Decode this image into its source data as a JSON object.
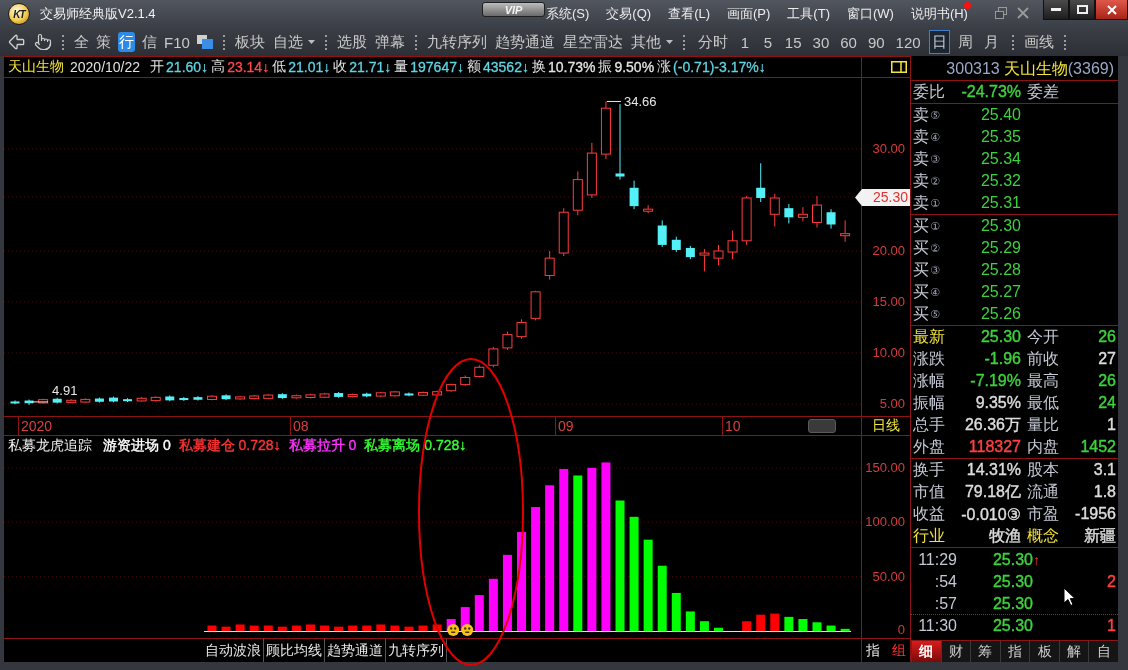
{
  "window": {
    "logo": "KT",
    "title": "交易师经典版V2.1.4",
    "vip": "VIP"
  },
  "menu": [
    {
      "label": "系统(S)",
      "badge": false
    },
    {
      "label": "交易(Q)",
      "badge": false
    },
    {
      "label": "查看(L)",
      "badge": false
    },
    {
      "label": "画面(P)",
      "badge": false
    },
    {
      "label": "工具(T)",
      "badge": false
    },
    {
      "label": "窗口(W)",
      "badge": false
    },
    {
      "label": "说明书(H)",
      "badge": true
    }
  ],
  "toolbar": {
    "views": [
      {
        "label": "全",
        "selected": false
      },
      {
        "label": "策",
        "selected": false
      },
      {
        "label": "行",
        "selected": true
      },
      {
        "label": "信",
        "selected": false
      },
      {
        "label": "F10",
        "selected": false
      }
    ],
    "groups": [
      [
        {
          "label": "板块",
          "dropdown": false
        },
        {
          "label": "自选",
          "dropdown": true
        }
      ],
      [
        {
          "label": "选股",
          "dropdown": false
        },
        {
          "label": "弹幕",
          "dropdown": false
        }
      ],
      [
        {
          "label": "九转序列",
          "dropdown": false
        },
        {
          "label": "趋势通道",
          "dropdown": false
        },
        {
          "label": "星空雷达",
          "dropdown": false
        },
        {
          "label": "其他",
          "dropdown": true
        }
      ]
    ],
    "periods": [
      {
        "label": "分时",
        "selected": false
      },
      {
        "label": "1",
        "selected": false
      },
      {
        "label": "5",
        "selected": false
      },
      {
        "label": "15",
        "selected": false
      },
      {
        "label": "30",
        "selected": false
      },
      {
        "label": "60",
        "selected": false
      },
      {
        "label": "90",
        "selected": false
      },
      {
        "label": "120",
        "selected": false
      },
      {
        "label": "日",
        "selected": true
      },
      {
        "label": "周",
        "selected": false
      },
      {
        "label": "月",
        "selected": false
      }
    ],
    "drawing": [
      {
        "label": "画线"
      }
    ]
  },
  "chart": {
    "header": {
      "name": "天山生物",
      "date": "2020/10/22",
      "quote": [
        {
          "label": "开",
          "value": "21.60↓",
          "color": "#5fd4e4"
        },
        {
          "label": "高",
          "value": "23.14↓",
          "color": "#ff4a4a"
        },
        {
          "label": "低",
          "value": "21.01↓",
          "color": "#5fd4e4"
        },
        {
          "label": "收",
          "value": "21.71↓",
          "color": "#5fd4e4"
        },
        {
          "label": "量",
          "value": "197647↓",
          "color": "#5fd4e4"
        },
        {
          "label": "额",
          "value": "43562↓",
          "color": "#5fd4e4"
        },
        {
          "label": "换",
          "value": "10.73%",
          "color": "#e4e4e4"
        },
        {
          "label": "振",
          "value": "9.50%",
          "color": "#e4e4e4"
        },
        {
          "label": "涨",
          "value": "(-0.71)-3.17%↓",
          "color": "#5fd4e4"
        }
      ]
    },
    "price_ticks": [
      "30.00",
      "20.00",
      "15.00",
      "10.00",
      "5.00"
    ],
    "price_tag": "25.30",
    "peak_label": "34.66",
    "low_label": "4.91",
    "dates": [
      "2020",
      "08",
      "09",
      "10"
    ],
    "period_label": "日线"
  },
  "indicator": {
    "name": "私募龙虎追踪",
    "legend": [
      {
        "label": "游资进场",
        "value": "0",
        "color": "#ffffff"
      },
      {
        "label": "私募建仓",
        "value": "0.728↓",
        "color": "#ff3333"
      },
      {
        "label": "私募拉升",
        "value": "0",
        "color": "#ff33ff"
      },
      {
        "label": "私募离场",
        "value": "0.728↓",
        "color": "#33ff33"
      }
    ],
    "axis_labels": [
      "150.00",
      "100.00",
      "50.00",
      "0"
    ]
  },
  "bottom_tabs": [
    {
      "label": "自动波浪"
    },
    {
      "label": "顾比均线"
    },
    {
      "label": "趋势通道"
    },
    {
      "label": "九转序列"
    }
  ],
  "axis_tabs": [
    {
      "label": "指",
      "selected": false
    },
    {
      "label": "组",
      "selected": true
    }
  ],
  "quote_panel": {
    "code": "300313",
    "name": "天山生物",
    "count": "(3369)",
    "ratio": {
      "label": "委比",
      "value": "-24.73%",
      "color": "#3dd23d",
      "label2": "委差"
    },
    "asks": [
      {
        "side": "卖",
        "rank": "⑤",
        "price": "25.40",
        "color": "#3dd23d"
      },
      {
        "side": "卖",
        "rank": "④",
        "price": "25.35",
        "color": "#3dd23d"
      },
      {
        "side": "卖",
        "rank": "③",
        "price": "25.34",
        "color": "#3dd23d"
      },
      {
        "side": "卖",
        "rank": "②",
        "price": "25.32",
        "color": "#3dd23d"
      },
      {
        "side": "卖",
        "rank": "①",
        "price": "25.31",
        "color": "#3dd23d"
      }
    ],
    "bids": [
      {
        "side": "买",
        "rank": "①",
        "price": "25.30",
        "color": "#3dd23d"
      },
      {
        "side": "买",
        "rank": "②",
        "price": "25.29",
        "color": "#3dd23d"
      },
      {
        "side": "买",
        "rank": "③",
        "price": "25.28",
        "color": "#3dd23d"
      },
      {
        "side": "买",
        "rank": "④",
        "price": "25.27",
        "color": "#3dd23d"
      },
      {
        "side": "买",
        "rank": "⑤",
        "price": "25.26",
        "color": "#3dd23d"
      }
    ],
    "stats": [
      [
        {
          "label": "最新",
          "value": "25.30",
          "color": "#3dd23d",
          "highlight": true
        },
        {
          "label": "今开",
          "value": "26",
          "color": "#3dd23d",
          "highlight": false
        }
      ],
      [
        {
          "label": "涨跌",
          "value": "-1.96",
          "color": "#3dd23d",
          "highlight": false
        },
        {
          "label": "前收",
          "value": "27",
          "color": "#dcdcdc",
          "highlight": false
        }
      ],
      [
        {
          "label": "涨幅",
          "value": "-7.19%",
          "color": "#3dd23d",
          "highlight": false
        },
        {
          "label": "最高",
          "value": "26",
          "color": "#3dd23d",
          "highlight": false
        }
      ],
      [
        {
          "label": "振幅",
          "value": "9.35%",
          "color": "#dcdcdc",
          "highlight": false
        },
        {
          "label": "最低",
          "value": "24",
          "color": "#3dd23d",
          "highlight": false
        }
      ],
      [
        {
          "label": "总手",
          "value": "26.36万",
          "color": "#dcdcdc",
          "highlight": false
        },
        {
          "label": "量比",
          "value": "1",
          "color": "#dcdcdc",
          "highlight": false
        }
      ],
      [
        {
          "label": "外盘",
          "value": "118327",
          "color": "#ff4040",
          "highlight": false
        },
        {
          "label": "内盘",
          "value": "1452",
          "color": "#3dd23d",
          "highlight": false
        }
      ]
    ],
    "fundamentals": [
      [
        {
          "label": "换手",
          "value": "14.31%",
          "color": "#dcdcdc",
          "highlight": false
        },
        {
          "label": "股本",
          "value": "3.1",
          "color": "#dcdcdc",
          "highlight": false
        }
      ],
      [
        {
          "label": "市值",
          "value": "79.18亿",
          "color": "#dcdcdc",
          "highlight": false
        },
        {
          "label": "流通",
          "value": "1.8",
          "color": "#dcdcdc",
          "highlight": false
        }
      ],
      [
        {
          "label": "收益",
          "value": "-0.010③",
          "color": "#dcdcdc",
          "highlight": false
        },
        {
          "label": "市盈",
          "value": "-1956",
          "color": "#dcdcdc",
          "highlight": false
        }
      ],
      [
        {
          "label": "行业",
          "value": "牧渔",
          "highlight": true
        },
        {
          "label": "概念",
          "value": "新疆",
          "highlight": true
        }
      ]
    ],
    "ticks": [
      {
        "time": "11:29",
        "price": "25.30",
        "color": "#3dd23d",
        "arrow": "↑",
        "divider_above": false
      },
      {
        "time": ":54",
        "price": "25.30",
        "color": "#3dd23d",
        "volume": {
          "text": "2",
          "color": "#ff4040"
        },
        "divider_above": false
      },
      {
        "time": ":57",
        "price": "25.30",
        "color": "#3dd23d",
        "divider_above": false
      },
      {
        "time": "11:30",
        "price": "25.30",
        "color": "#3dd23d",
        "volume": {
          "text": "1",
          "color": "#ff4040"
        },
        "divider_above": true
      }
    ],
    "tabs": [
      {
        "label": "细",
        "selected": true
      },
      {
        "label": "财",
        "selected": false
      },
      {
        "label": "筹",
        "selected": false
      },
      {
        "label": "指",
        "selected": false
      },
      {
        "label": "板",
        "selected": false
      },
      {
        "label": "解",
        "selected": false
      },
      {
        "label": "自",
        "selected": false
      }
    ]
  }
}
